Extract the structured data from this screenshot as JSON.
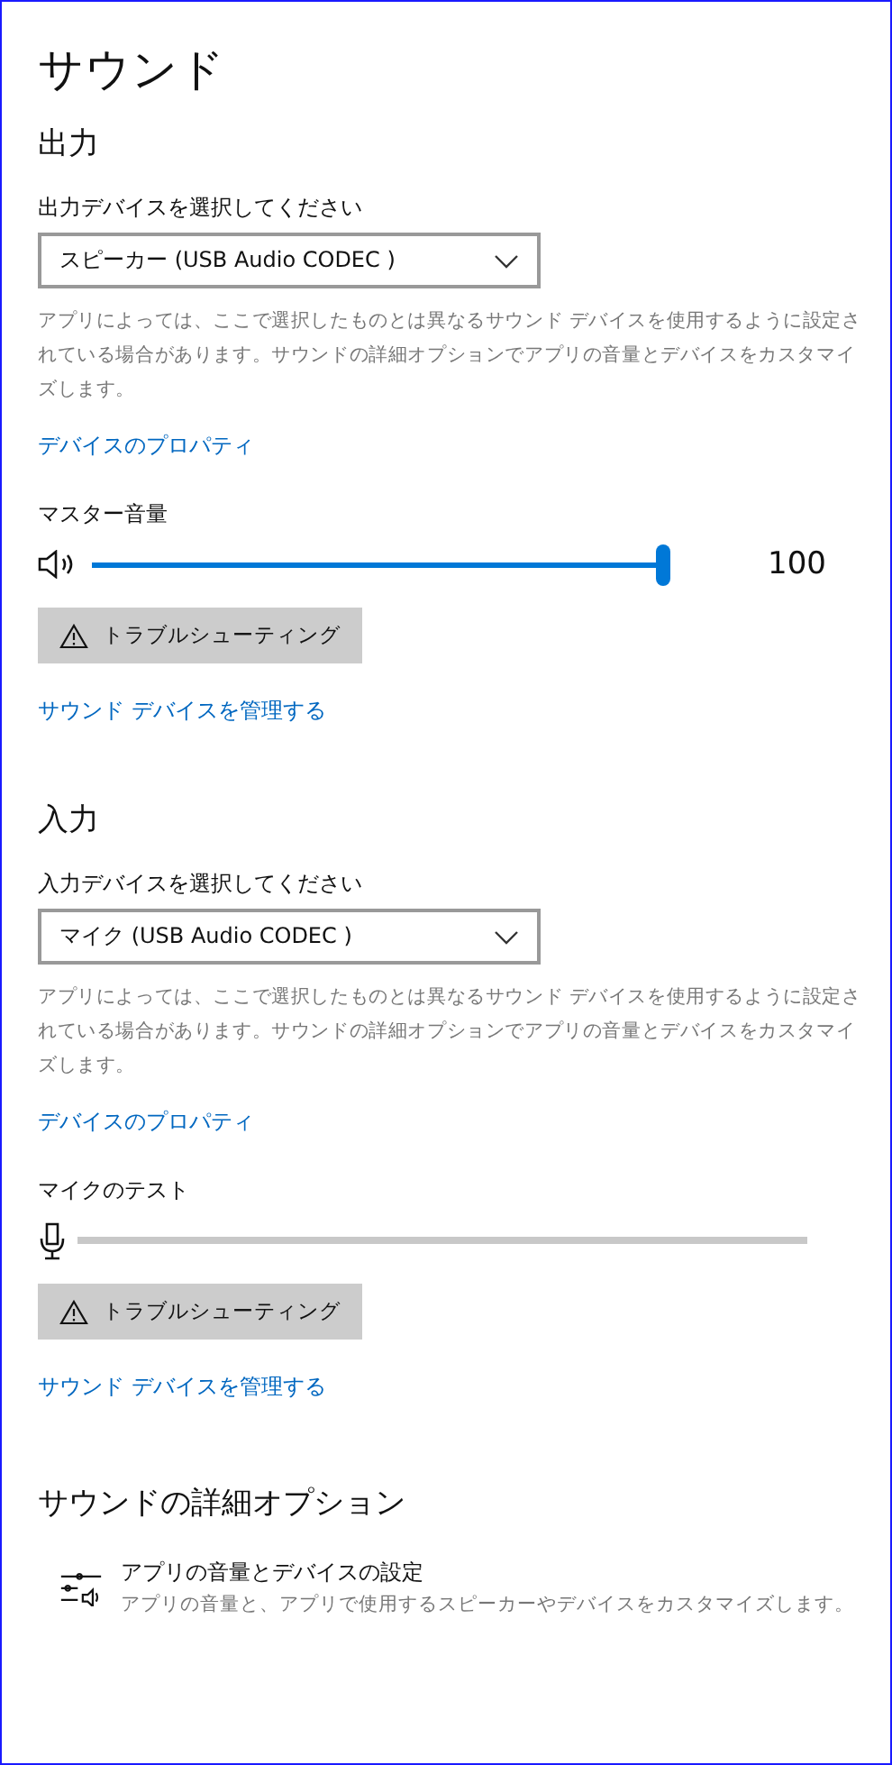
{
  "title": "サウンド",
  "sections": [
    {
      "heading": "出力",
      "select_label": "出力デバイスを選択してください",
      "device": "スピーカー (USB Audio CODEC )",
      "description": "アプリによっては、ここで選択したものとは異なるサウンド デバイスを使用するように設定されている場合があります。サウンドの詳細オプションでアプリの音量とデバイスをカスタマイズします。",
      "properties_link": "デバイスのプロパティ",
      "meter": {
        "kind": "volume",
        "label": "マスター音量",
        "level": 1.0,
        "reading": "100"
      },
      "troubleshoot_button": "トラブルシューティング",
      "manage_link": "サウンド デバイスを管理する"
    },
    {
      "heading": "入力",
      "select_label": "入力デバイスを選択してください",
      "device": "マイク (USB Audio CODEC )",
      "description": "アプリによっては、ここで選択したものとは異なるサウンド デバイスを使用するように設定されている場合があります。サウンドの詳細オプションでアプリの音量とデバイスをカスタマイズします。",
      "properties_link": "デバイスのプロパティ",
      "meter": {
        "kind": "mic",
        "label": "マイクのテスト",
        "level": 0
      },
      "troubleshoot_button": "トラブルシューティング",
      "manage_link": "サウンド デバイスを管理する"
    }
  ],
  "advanced": {
    "heading": "サウンドの詳細オプション",
    "item": {
      "title": "アプリの音量とデバイスの設定",
      "subtitle": "アプリの音量と、アプリで使用するスピーカーやデバイスをカスタマイズします。"
    }
  }
}
